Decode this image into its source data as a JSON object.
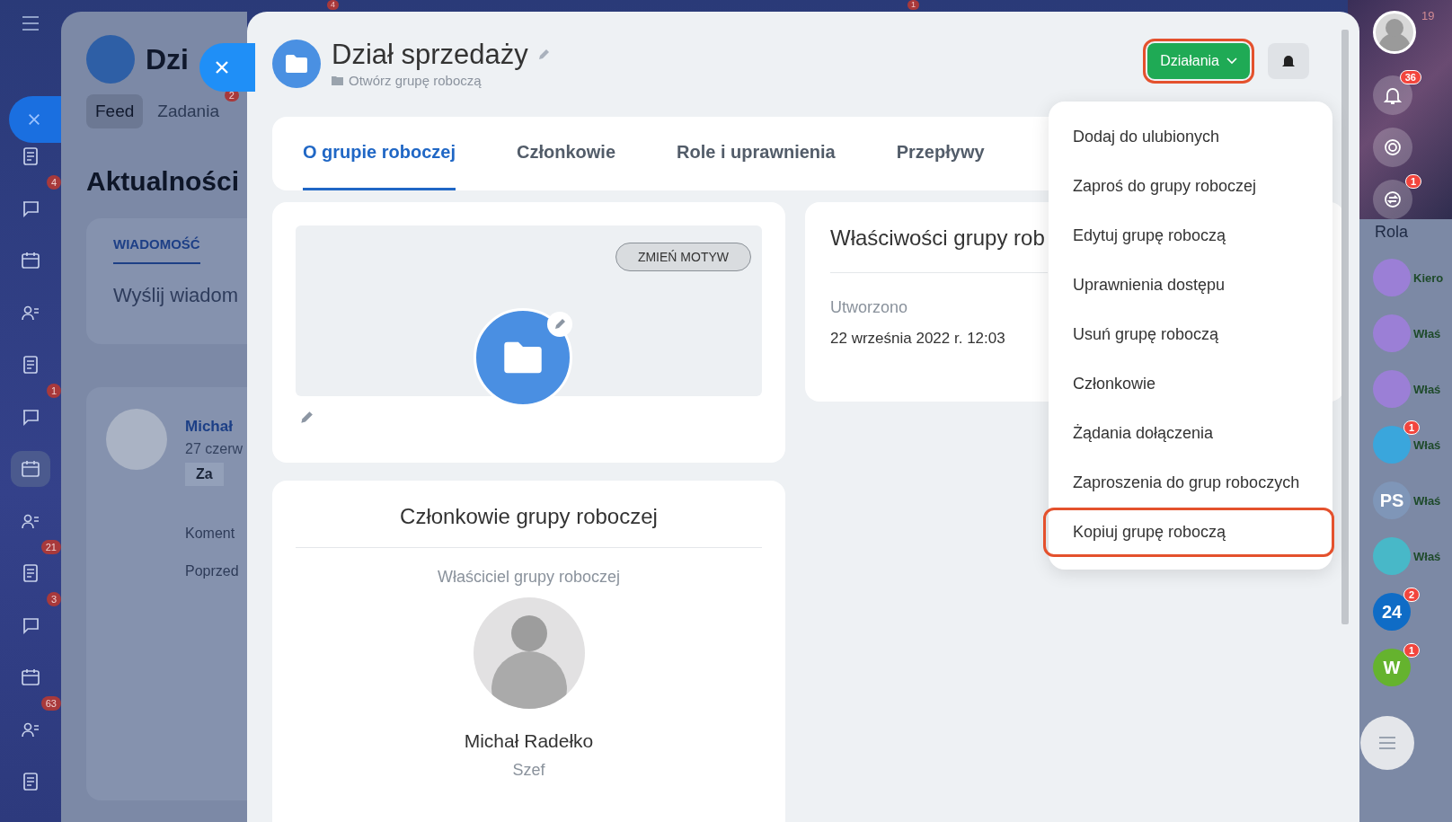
{
  "top_badges": [
    "4",
    "1"
  ],
  "left_nav": {
    "items": [
      {
        "selected": false
      },
      {
        "selected": false,
        "badge": "4"
      },
      {
        "selected": false
      },
      {
        "selected": false
      },
      {
        "selected": false
      },
      {
        "selected": false,
        "badge": "1"
      },
      {
        "selected": true
      },
      {
        "selected": false
      },
      {
        "selected": false,
        "badge": "21"
      },
      {
        "selected": false,
        "badge": "3"
      },
      {
        "selected": false
      },
      {
        "selected": false,
        "badge": "63"
      },
      {
        "selected": false
      }
    ]
  },
  "background_page": {
    "title": "Dzi",
    "tabs": [
      {
        "label": "Feed",
        "selected": true
      },
      {
        "label": "Zadania",
        "selected": false,
        "badge": "2"
      }
    ],
    "heading": "Aktualności",
    "composer": {
      "tab": "WIADOMOŚĆ",
      "placeholder": "Wyślij wiadom"
    },
    "post": {
      "author": "Michał",
      "date": "27 czerw",
      "chip": "Za",
      "comment": "Koment",
      "previous": "Poprzed"
    }
  },
  "group": {
    "title": "Dział sprzedaży",
    "subtitle": "Otwórz grupę roboczą",
    "actions_button": {
      "label": "Działania",
      "highlighted": true
    },
    "tabs": [
      {
        "label": "O grupie roboczej",
        "selected": true
      },
      {
        "label": "Członkowie",
        "selected": false
      },
      {
        "label": "Role i uprawnienia",
        "selected": false
      },
      {
        "label": "Przepływy",
        "selected": false
      }
    ],
    "cover_button": "ZMIEŃ MOTYW",
    "members": {
      "title": "Członkowie grupy roboczej",
      "owner_label": "Właściciel grupy roboczej",
      "owner_name": "Michał Radełko",
      "owner_role": "Szef"
    },
    "properties": {
      "title": "Właściwości grupy rob",
      "created_label": "Utworzono",
      "created_value": "22 września 2022 r. 12:03"
    }
  },
  "actions_menu": {
    "items": [
      {
        "label": "Dodaj do ulubionych",
        "selected": false
      },
      {
        "label": "Zaproś do grupy roboczej",
        "selected": false
      },
      {
        "label": "Edytuj grupę roboczą",
        "selected": false
      },
      {
        "label": "Uprawnienia dostępu",
        "selected": false
      },
      {
        "label": "Usuń grupę roboczą",
        "selected": false
      },
      {
        "label": "Członkowie",
        "selected": false
      },
      {
        "label": "Żądania dołączenia",
        "selected": false
      },
      {
        "label": "Zaproszenia do grup roboczych",
        "selected": false
      },
      {
        "label": "Kopiuj grupę roboczą",
        "selected": true
      }
    ]
  },
  "right_bar": {
    "avatar_badge": "19",
    "notifications_badge": "36",
    "role_badge": "1",
    "role_label": "Rola",
    "apps": [
      {
        "color": "#9b7fd6",
        "label": "Kiero"
      },
      {
        "color": "#9b7fd6",
        "label": "Właś"
      },
      {
        "color": "#9b7fd6",
        "label": "Właś"
      },
      {
        "color": "#3aa6dc",
        "badge": "1",
        "label": "Właś"
      },
      {
        "color": "#7f96b8",
        "text": "PS",
        "label": "Właś"
      },
      {
        "color": "#48b8c8",
        "label": "Właś"
      },
      {
        "color": "#0f6cc6",
        "text": "24",
        "badge": "2"
      },
      {
        "color": "#65b32e",
        "text": "W",
        "badge": "1"
      }
    ]
  }
}
